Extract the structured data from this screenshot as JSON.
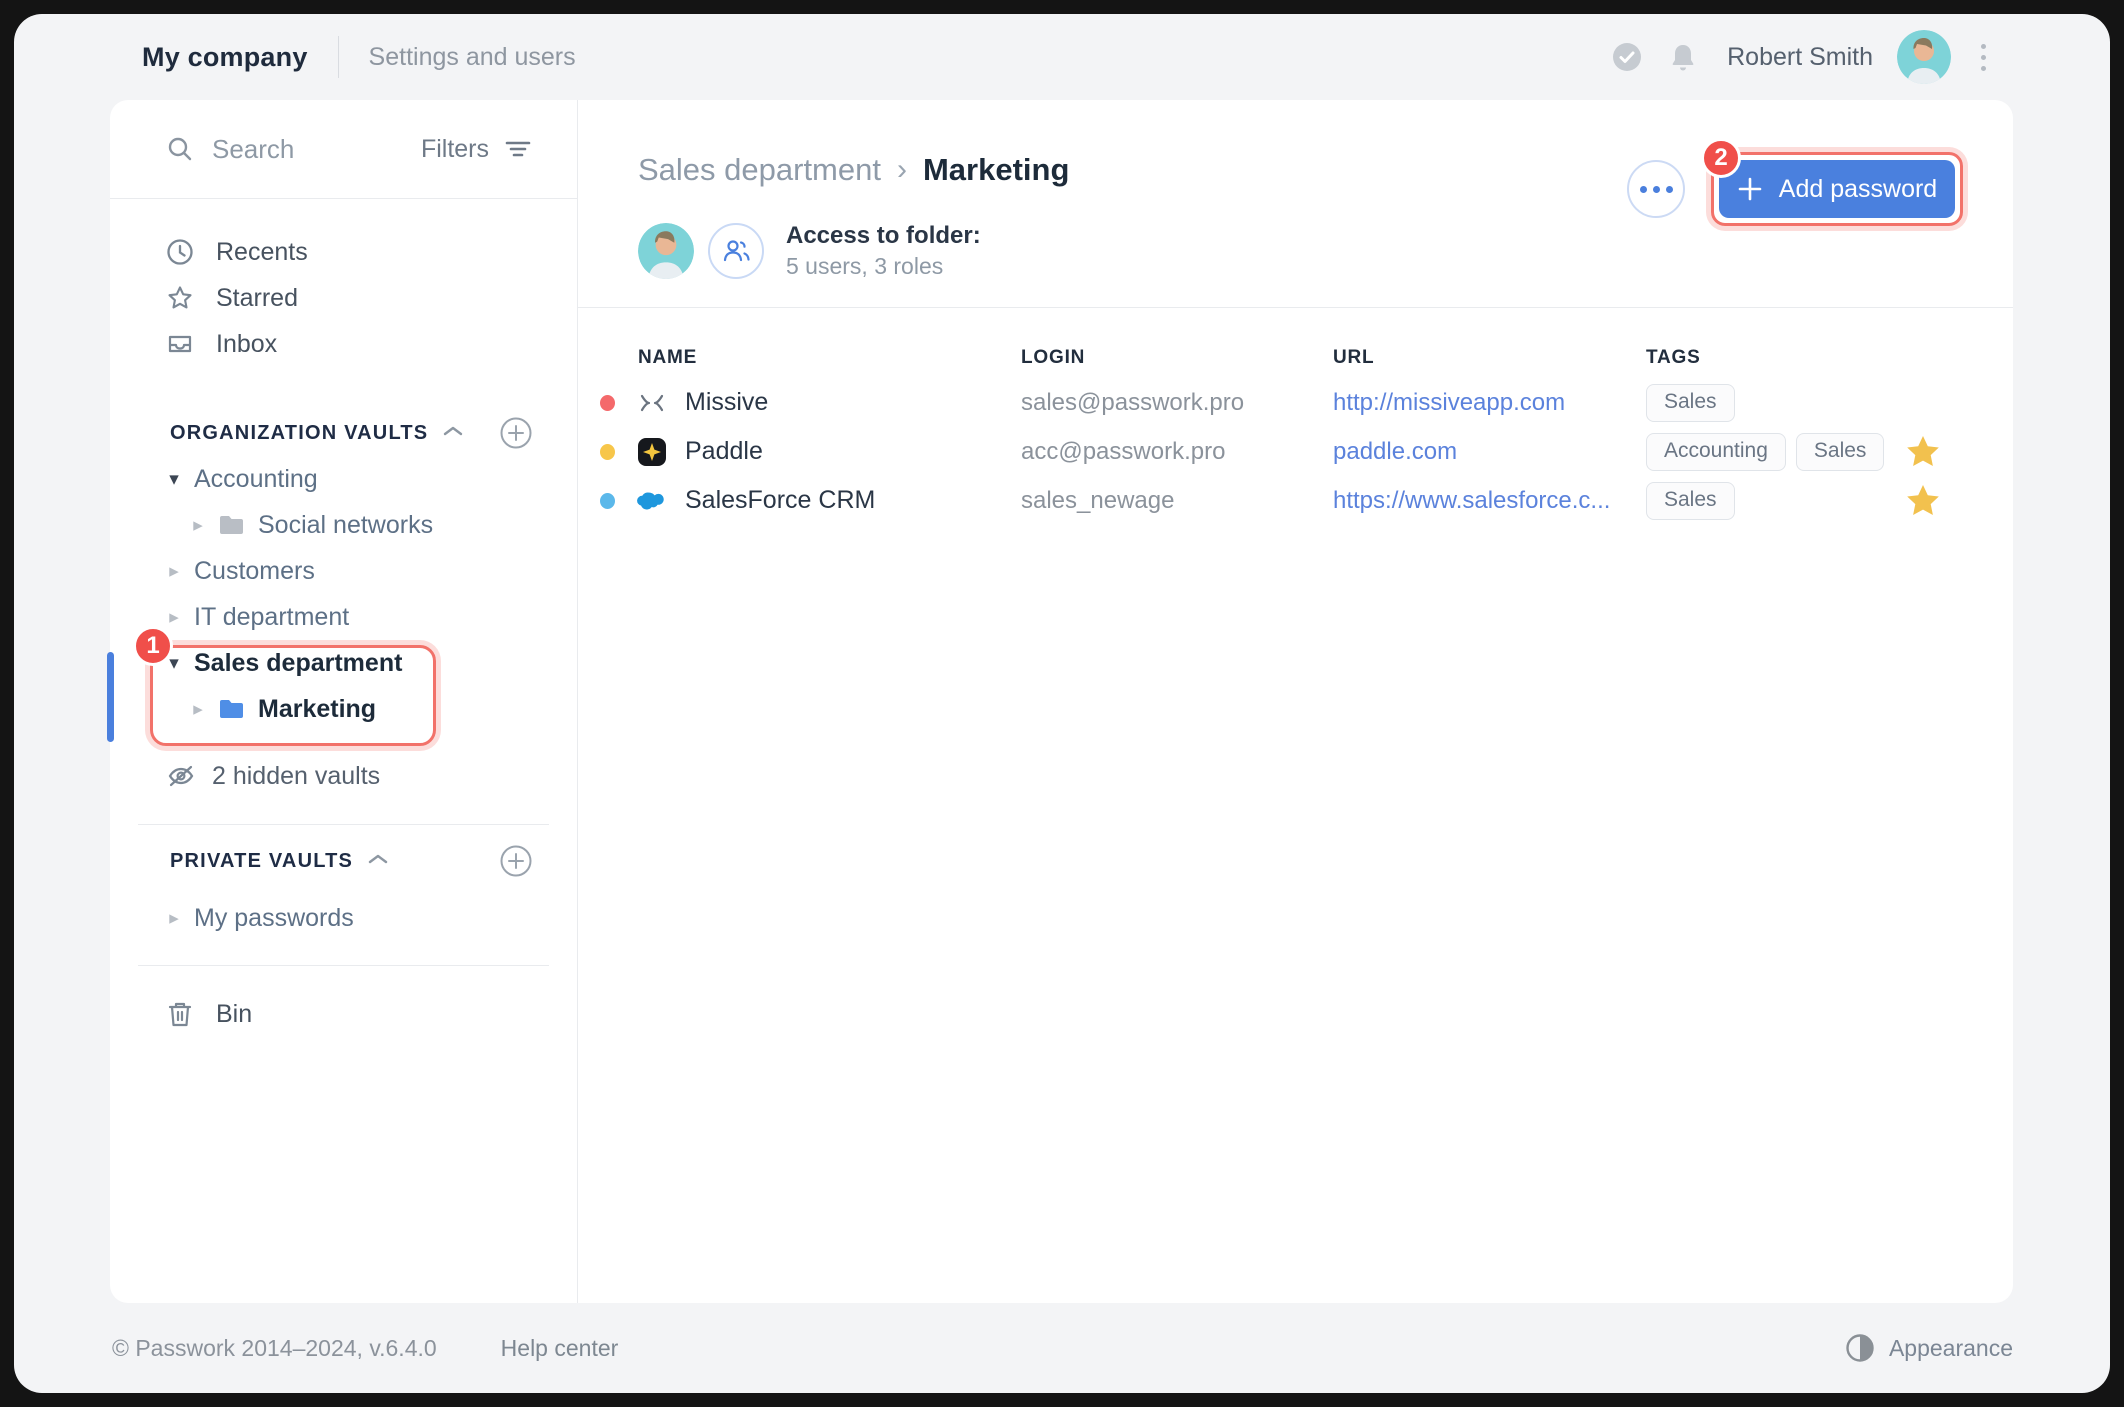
{
  "topbar": {
    "title": "My company",
    "subtitle": "Settings and users",
    "user_name": "Robert Smith"
  },
  "sidebar": {
    "search_placeholder": "Search",
    "filters_label": "Filters",
    "nav": {
      "recents": "Recents",
      "starred": "Starred",
      "inbox": "Inbox"
    },
    "org_section_title": "ORGANIZATION VAULTS",
    "org_vaults": {
      "accounting": "Accounting",
      "social_networks": "Social networks",
      "customers": "Customers",
      "it_department": "IT department",
      "sales_department": "Sales department",
      "marketing": "Marketing"
    },
    "hidden_vaults_label": "2 hidden vaults",
    "private_section_title": "PRIVATE VAULTS",
    "private_vaults": {
      "my_passwords": "My passwords"
    },
    "bin_label": "Bin"
  },
  "annotations": {
    "step1": "1",
    "step2": "2"
  },
  "main": {
    "breadcrumb": {
      "parent": "Sales department",
      "current": "Marketing"
    },
    "access": {
      "title": "Access to folder:",
      "subtitle": "5 users, 3 roles"
    },
    "add_password_label": "Add password",
    "table": {
      "columns": {
        "name": "NAME",
        "login": "LOGIN",
        "url": "URL",
        "tags": "TAGS"
      },
      "rows": [
        {
          "name": "Missive",
          "dot_color": "#f4696b",
          "login": "sales@passwork.pro",
          "url": "http://missiveapp.com",
          "tags": [
            "Sales"
          ],
          "starred": false
        },
        {
          "name": "Paddle",
          "dot_color": "#f7c64a",
          "login": "acc@passwork.pro",
          "url": "paddle.com",
          "tags": [
            "Accounting",
            "Sales"
          ],
          "starred": true
        },
        {
          "name": "SalesForce CRM",
          "dot_color": "#5bb8ea",
          "login": "sales_newage",
          "url": "https://www.salesforce.c...",
          "tags": [
            "Sales"
          ],
          "starred": true
        }
      ]
    }
  },
  "footer": {
    "copyright": "© Passwork 2014–2024, v.6.4.0",
    "help": "Help center",
    "appearance": "Appearance"
  },
  "colors": {
    "accent_blue": "#4a80de",
    "link_blue": "#5b82dc",
    "annotation_red": "#f2726a",
    "badge_red": "#f04f4a",
    "star_yellow": "#f2c14e",
    "active_bar_blue": "#4a7fdd",
    "dot_red": "#f4696b",
    "dot_yellow": "#f7c64a",
    "dot_blue": "#5bb8ea"
  }
}
